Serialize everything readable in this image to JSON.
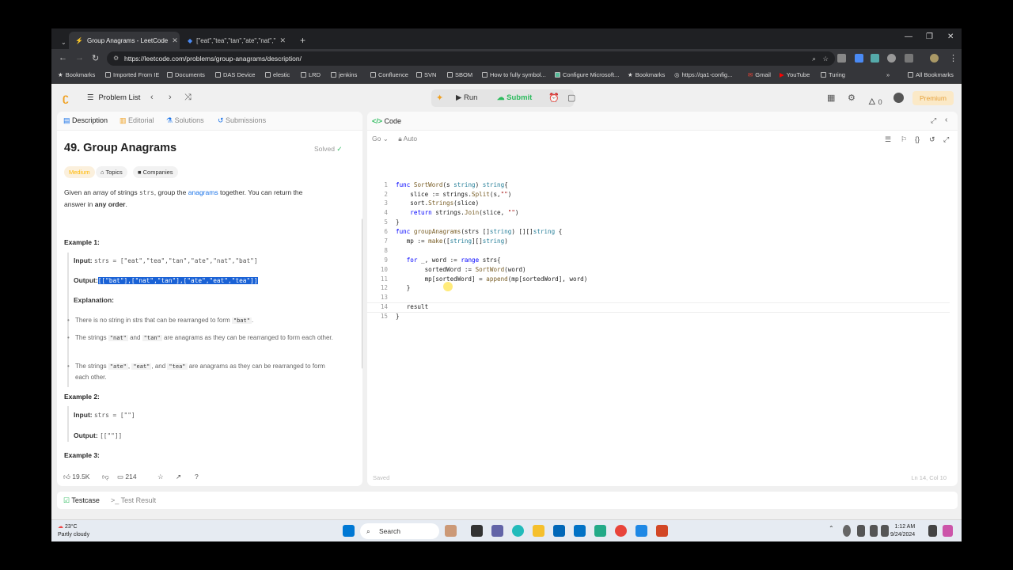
{
  "browser": {
    "tabs": [
      {
        "title": "Group Anagrams - LeetCode"
      },
      {
        "title": "[\"eat\",\"tea\",\"tan\",\"ate\",\"nat\",\"ba"
      }
    ],
    "new_tab": "+",
    "url": "https://leetcode.com/problems/group-anagrams/description/",
    "bookmarks": [
      "Bookmarks",
      "Imported From IE",
      "Documents",
      "DAS Device",
      "elestic",
      "LRD",
      "jenkins",
      "Confluence",
      "SVN",
      "SBOM",
      "How to fully symbol...",
      "Configure Microsoft...",
      "Bookmarks",
      "https://qa1-config...",
      "Gmail",
      "YouTube",
      "Turing",
      "All Bookmarks"
    ]
  },
  "header": {
    "problem_list": "Problem List",
    "run": "Run",
    "submit": "Submit",
    "streak": "0",
    "premium": "Premium"
  },
  "left": {
    "tabs": [
      "Description",
      "Editorial",
      "Solutions",
      "Submissions"
    ],
    "title": "49. Group Anagrams",
    "solved": "Solved",
    "difficulty": "Medium",
    "topics": "Topics",
    "companies": "Companies",
    "desc_a": "Given an array of strings ",
    "desc_code": "strs",
    "desc_b": ", group the ",
    "desc_link": "anagrams",
    "desc_c": " together. You can return the",
    "desc_d": "answer in ",
    "desc_bold": "any order",
    "desc_e": ".",
    "ex1": "Example 1:",
    "ex1_input_label": "Input:",
    "ex1_input": "strs = [\"eat\",\"tea\",\"tan\",\"ate\",\"nat\",\"bat\"]",
    "ex1_output_label": "Output:",
    "ex1_output": "[[\"bat\"],[\"nat\",\"tan\"],[\"ate\",\"eat\",\"tea\"]]",
    "explanation": "Explanation:",
    "b1_a": "There is no string in strs that can be rearranged to form ",
    "b1_c": "\"bat\"",
    "b1_e": ".",
    "b2_a": "The strings ",
    "b2_c1": "\"nat\"",
    "b2_and": " and ",
    "b2_c2": "\"tan\"",
    "b2_b": " are anagrams as they can be rearranged to form each other.",
    "b3_a": "The strings ",
    "b3_c1": "\"ate\"",
    "b3_comma": ", ",
    "b3_c2": "\"eat\"",
    "b3_and": ", and ",
    "b3_c3": "\"tea\"",
    "b3_b": " are anagrams as they can be rearranged to form each other.",
    "ex2": "Example 2:",
    "ex2_input_label": "Input:",
    "ex2_input": "strs = [\"\"]",
    "ex2_output_label": "Output:",
    "ex2_output": "[[\"\"]]",
    "ex3": "Example 3:",
    "likes": "19.5K",
    "comments": "214"
  },
  "right": {
    "title": "Code",
    "lang": "Go",
    "auto": "Auto",
    "saved": "Saved",
    "cursor_pos": "Ln 14, Col 10",
    "line_numbers": [
      "1",
      "2",
      "3",
      "4",
      "5",
      "6",
      "7",
      "8",
      "9",
      "10",
      "11",
      "12",
      "13",
      "14",
      "15"
    ]
  },
  "bottom": {
    "testcase": "Testcase",
    "test_result": "Test Result"
  },
  "taskbar": {
    "temp": "23°C",
    "weather": "Partly cloudy",
    "search": "Search",
    "time": "1:12 AM",
    "date": "9/24/2024"
  }
}
